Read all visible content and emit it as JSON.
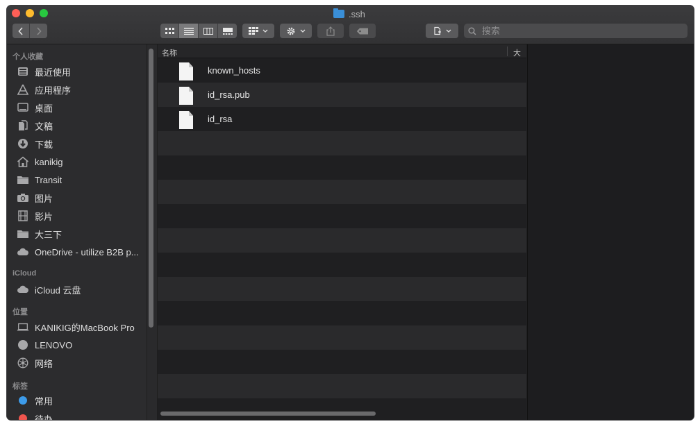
{
  "window": {
    "title": ".ssh"
  },
  "toolbar": {
    "search_placeholder": "搜索"
  },
  "sidebar": {
    "sections": [
      {
        "heading": "个人收藏",
        "items": [
          {
            "label": "最近使用",
            "icon": "clock-icon"
          },
          {
            "label": "应用程序",
            "icon": "applications-icon"
          },
          {
            "label": "桌面",
            "icon": "desktop-icon"
          },
          {
            "label": "文稿",
            "icon": "documents-icon"
          },
          {
            "label": "下载",
            "icon": "download-icon"
          },
          {
            "label": "kanikig",
            "icon": "home-icon"
          },
          {
            "label": "Transit",
            "icon": "folder-icon"
          },
          {
            "label": "图片",
            "icon": "camera-icon"
          },
          {
            "label": "影片",
            "icon": "film-icon"
          },
          {
            "label": "大三下",
            "icon": "folder-icon"
          },
          {
            "label": "OneDrive - utilize B2B p...",
            "icon": "cloud-icon"
          }
        ]
      },
      {
        "heading": "iCloud",
        "items": [
          {
            "label": "iCloud 云盘",
            "icon": "cloud-icon"
          }
        ]
      },
      {
        "heading": "位置",
        "items": [
          {
            "label": "KANIKIG的MacBook Pro",
            "icon": "laptop-icon"
          },
          {
            "label": "LENOVO",
            "icon": "disk-icon"
          },
          {
            "label": "网络",
            "icon": "network-icon"
          }
        ]
      },
      {
        "heading": "标签",
        "items": [
          {
            "label": "常用",
            "icon": "tag-dot-icon",
            "color": "#3d9be9"
          },
          {
            "label": "待办",
            "icon": "tag-dot-icon",
            "color": "#f0554e"
          }
        ]
      }
    ]
  },
  "file_list": {
    "columns": [
      "名称",
      "大小"
    ],
    "files": [
      "known_hosts",
      "id_rsa.pub",
      "id_rsa"
    ]
  }
}
